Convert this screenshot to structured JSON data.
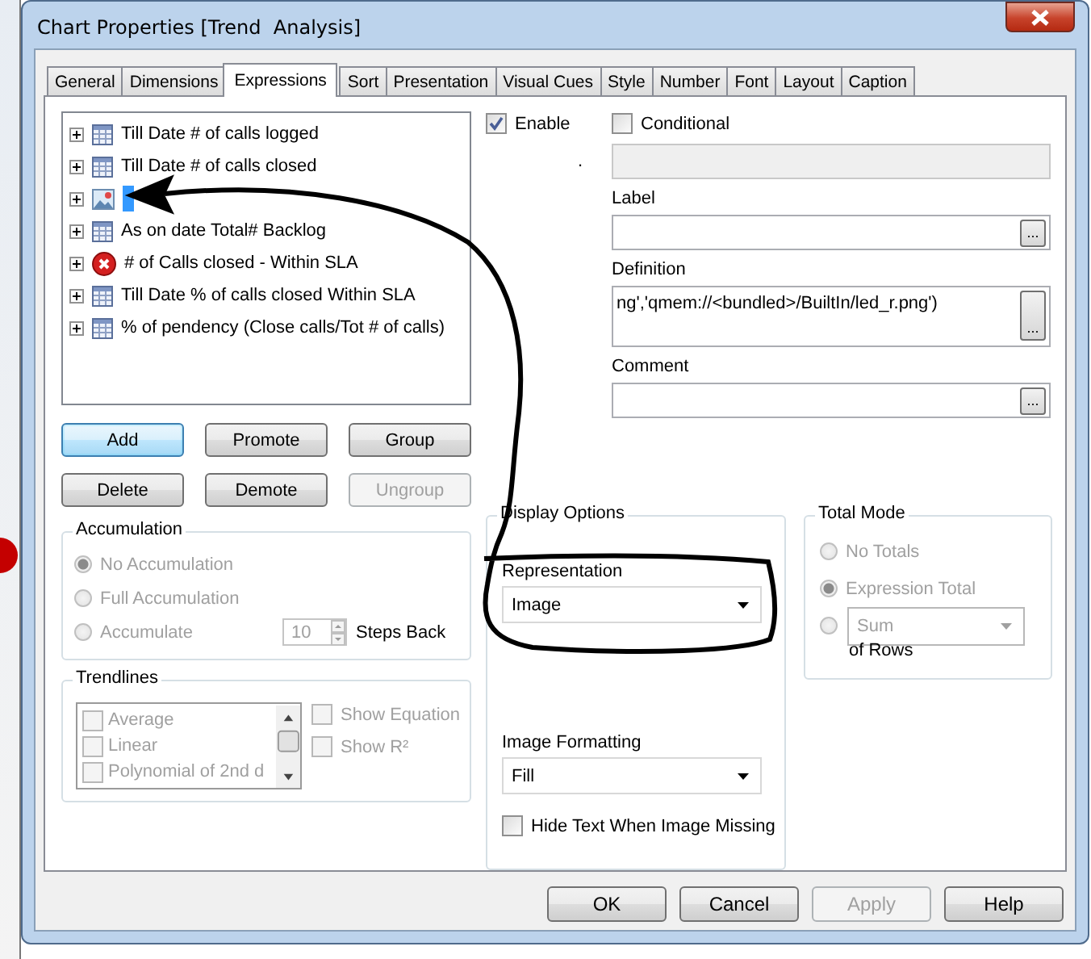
{
  "window": {
    "title": "Chart Properties [Trend  Analysis]"
  },
  "tabs": [
    {
      "label": "General",
      "selected": false
    },
    {
      "label": "Dimensions",
      "selected": false
    },
    {
      "label": "Expressions",
      "selected": true
    },
    {
      "label": "Sort",
      "selected": false
    },
    {
      "label": "Presentation",
      "selected": false
    },
    {
      "label": "Visual Cues",
      "selected": false
    },
    {
      "label": "Style",
      "selected": false
    },
    {
      "label": "Number",
      "selected": false
    },
    {
      "label": "Font",
      "selected": false
    },
    {
      "label": "Layout",
      "selected": false
    },
    {
      "label": "Caption",
      "selected": false
    }
  ],
  "expressions": [
    {
      "label": "Till Date # of calls logged",
      "kind": "table",
      "selected": false
    },
    {
      "label": "Till Date # of calls closed",
      "kind": "table",
      "selected": false
    },
    {
      "kind": "image",
      "selected": true
    },
    {
      "label": "As on date Total# Backlog",
      "kind": "table",
      "selected": false
    },
    {
      "label": "# of Calls closed - Within SLA",
      "kind": "error",
      "selected": false
    },
    {
      "label": "Till Date % of calls closed Within SLA",
      "kind": "table",
      "selected": false
    },
    {
      "label": "% of pendency (Close calls/Tot # of calls)",
      "kind": "table",
      "selected": false
    }
  ],
  "expression_buttons": [
    {
      "label": "Add",
      "focused": true,
      "disabled": false
    },
    {
      "label": "Promote",
      "focused": false,
      "disabled": false
    },
    {
      "label": "Group",
      "focused": false,
      "disabled": false
    },
    {
      "label": "Delete",
      "focused": false,
      "disabled": false
    },
    {
      "label": "Demote",
      "focused": false,
      "disabled": false
    },
    {
      "label": "Ungroup",
      "focused": false,
      "disabled": true
    }
  ],
  "accumulation": {
    "title": "Accumulation",
    "disabled": true,
    "options": [
      {
        "label": "No Accumulation",
        "selected": true
      },
      {
        "label": "Full Accumulation",
        "selected": false
      },
      {
        "label": "Accumulate",
        "selected": false
      }
    ],
    "steps": "10",
    "steps_label": "Steps Back"
  },
  "trendlines": {
    "title": "Trendlines",
    "disabled": true,
    "items": [
      {
        "label": "Average",
        "checked": false
      },
      {
        "label": "Linear",
        "checked": false
      },
      {
        "label": "Polynomial of 2nd d",
        "checked": false
      }
    ],
    "options": [
      {
        "label": "Show Equation",
        "checked": false
      },
      {
        "label": "Show R²",
        "checked": false
      }
    ]
  },
  "enable": {
    "label": "Enable",
    "checked": true
  },
  "conditional": {
    "label": "Conditional",
    "checked": false
  },
  "note": ".",
  "condition_field": {
    "disabled": true
  },
  "fields": [
    {
      "label": "Label",
      "multiline": false,
      "browse": "..."
    },
    {
      "label": "Definition",
      "value": "ng','qmem://<bundled>/BuiltIn/led_r.png')",
      "multiline": true,
      "browse": "..."
    },
    {
      "label": "Comment",
      "multiline": false,
      "browse": "..."
    }
  ],
  "display_options": {
    "title": "Display Options",
    "representation": {
      "label": "Representation",
      "value": "Image"
    },
    "image_formatting": {
      "label": "Image Formatting",
      "value": "Fill"
    },
    "hide_text": {
      "label": "Hide Text When Image Missing",
      "checked": false
    }
  },
  "total_mode": {
    "title": "Total Mode",
    "disabled": true,
    "options": [
      {
        "kind": "radio",
        "label": "No Totals",
        "selected": false
      },
      {
        "kind": "radio",
        "label": "Expression Total",
        "selected": true
      },
      {
        "kind": "dropdown",
        "value": "Sum",
        "suffix": "of Rows",
        "selected": false
      }
    ]
  },
  "dialog_buttons": [
    {
      "label": "OK",
      "disabled": false
    },
    {
      "label": "Cancel",
      "disabled": false
    },
    {
      "label": "Apply",
      "disabled": true
    },
    {
      "label": "Help",
      "disabled": false
    }
  ]
}
